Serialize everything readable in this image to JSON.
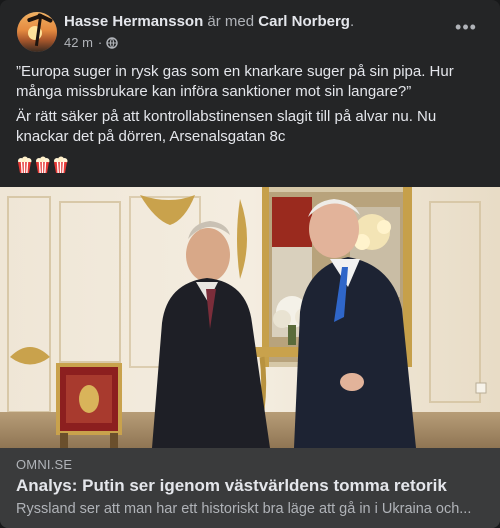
{
  "post": {
    "author": "Hasse Hermansson",
    "with_text": "är med",
    "tagged": "Carl Norberg",
    "tagged_suffix": ".",
    "time": "42 m",
    "separator": "·",
    "privacy_icon": "globe-icon",
    "more_icon": "more-options-icon",
    "more_glyph": "•••",
    "text_paragraph_1": "”Europa suger in rysk gas som en knarkare suger på sin pipa. Hur många missbrukare kan införa sanktioner mot sin langare?”",
    "text_paragraph_2": "Är rätt säker på att kontrollabstinensen slagit till på alvar nu. Nu knackar det på dörren, Arsenalsgatan 8c",
    "emojis": [
      "popcorn-icon",
      "popcorn-icon",
      "popcorn-icon"
    ]
  },
  "link_preview": {
    "domain": "OMNI.SE",
    "title": "Analys: Putin ser igenom västvärldens tomma retorik",
    "description": "Ryssland ser att man har ett historiskt bra läge att gå in i Ukraina och..."
  },
  "colors": {
    "card_background": "#242526",
    "link_background": "#3a3b3c",
    "primary_text": "#e4e6eb",
    "secondary_text": "#b0b3b8"
  }
}
